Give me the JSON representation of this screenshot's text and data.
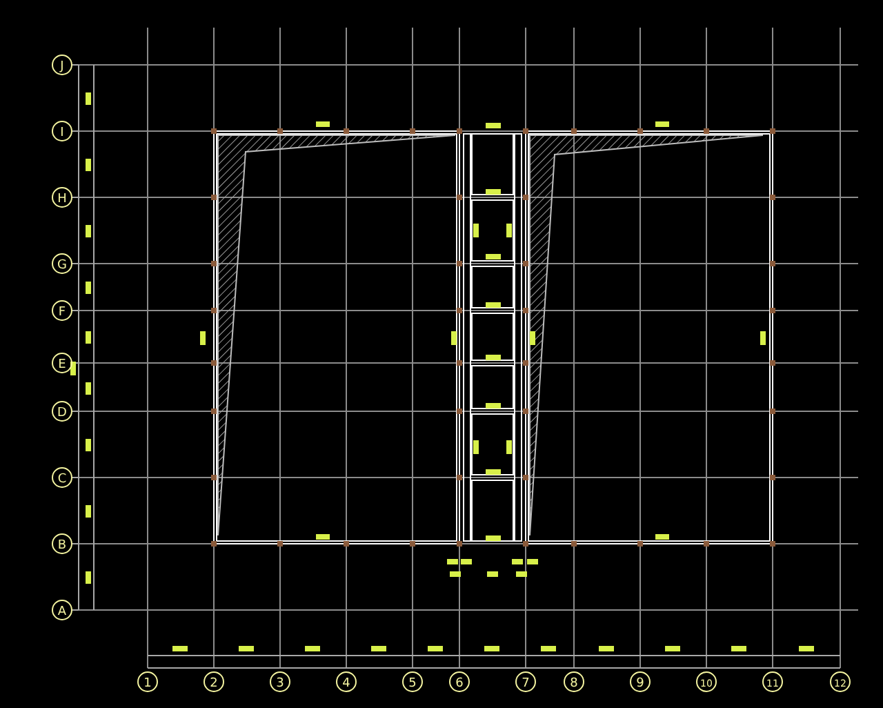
{
  "row_axes": [
    {
      "label": "J"
    },
    {
      "label": "I"
    },
    {
      "label": "H"
    },
    {
      "label": "G"
    },
    {
      "label": "F"
    },
    {
      "label": "E"
    },
    {
      "label": "D"
    },
    {
      "label": "C"
    },
    {
      "label": "B"
    },
    {
      "label": "A"
    }
  ],
  "column_axes": [
    {
      "label": "1"
    },
    {
      "label": "2"
    },
    {
      "label": "3"
    },
    {
      "label": "4"
    },
    {
      "label": "5"
    },
    {
      "label": "6"
    },
    {
      "label": "7"
    },
    {
      "label": "8"
    },
    {
      "label": "9"
    },
    {
      "label": "10"
    },
    {
      "label": "11"
    },
    {
      "label": "12"
    }
  ]
}
